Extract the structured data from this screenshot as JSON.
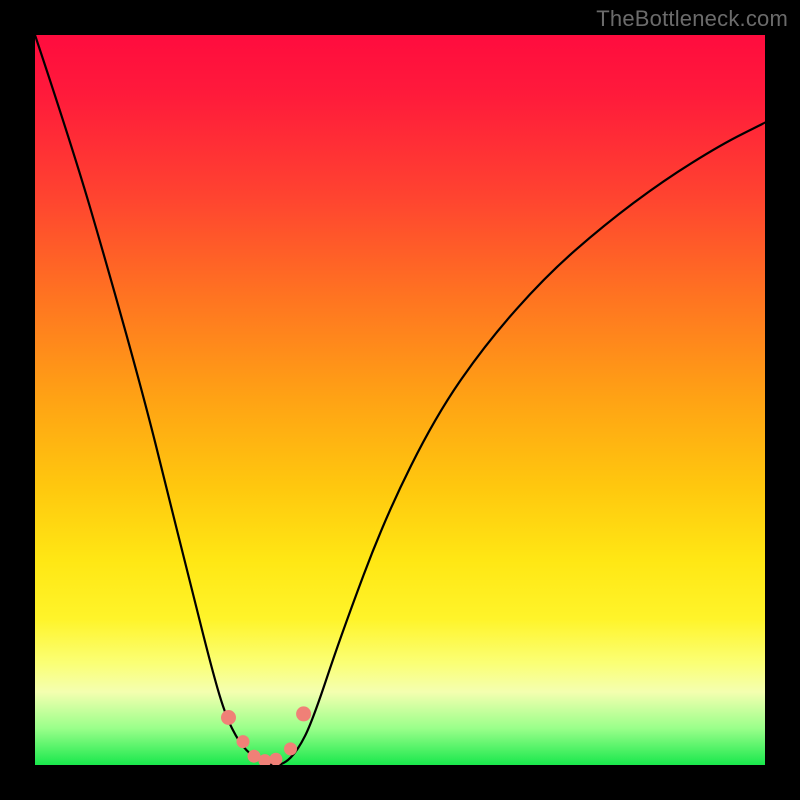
{
  "watermark_text": "TheBottleneck.com",
  "chart_data": {
    "type": "line",
    "title": "",
    "xlabel": "",
    "ylabel": "",
    "xlim": [
      0,
      100
    ],
    "ylim": [
      0,
      100
    ],
    "axes_visible": false,
    "grid": false,
    "background": "vertical-gradient-red-to-green",
    "series": [
      {
        "name": "bottleneck-curve",
        "x": [
          0,
          5,
          10,
          15,
          18,
          21,
          24,
          26,
          28,
          30,
          32,
          34,
          36,
          38,
          42,
          48,
          55,
          62,
          70,
          78,
          86,
          94,
          100
        ],
        "y": [
          100,
          85,
          68,
          50,
          38,
          26,
          14,
          7,
          3,
          1,
          0,
          0,
          2,
          6,
          18,
          34,
          48,
          58,
          67,
          74,
          80,
          85,
          88
        ]
      }
    ],
    "markers": {
      "name": "valley-dots",
      "color": "#f08077",
      "x": [
        26.5,
        28.5,
        30.0,
        31.5,
        33.0,
        35.0,
        36.8
      ],
      "y": [
        6.5,
        3.2,
        1.2,
        0.6,
        0.8,
        2.2,
        7.0
      ]
    }
  }
}
